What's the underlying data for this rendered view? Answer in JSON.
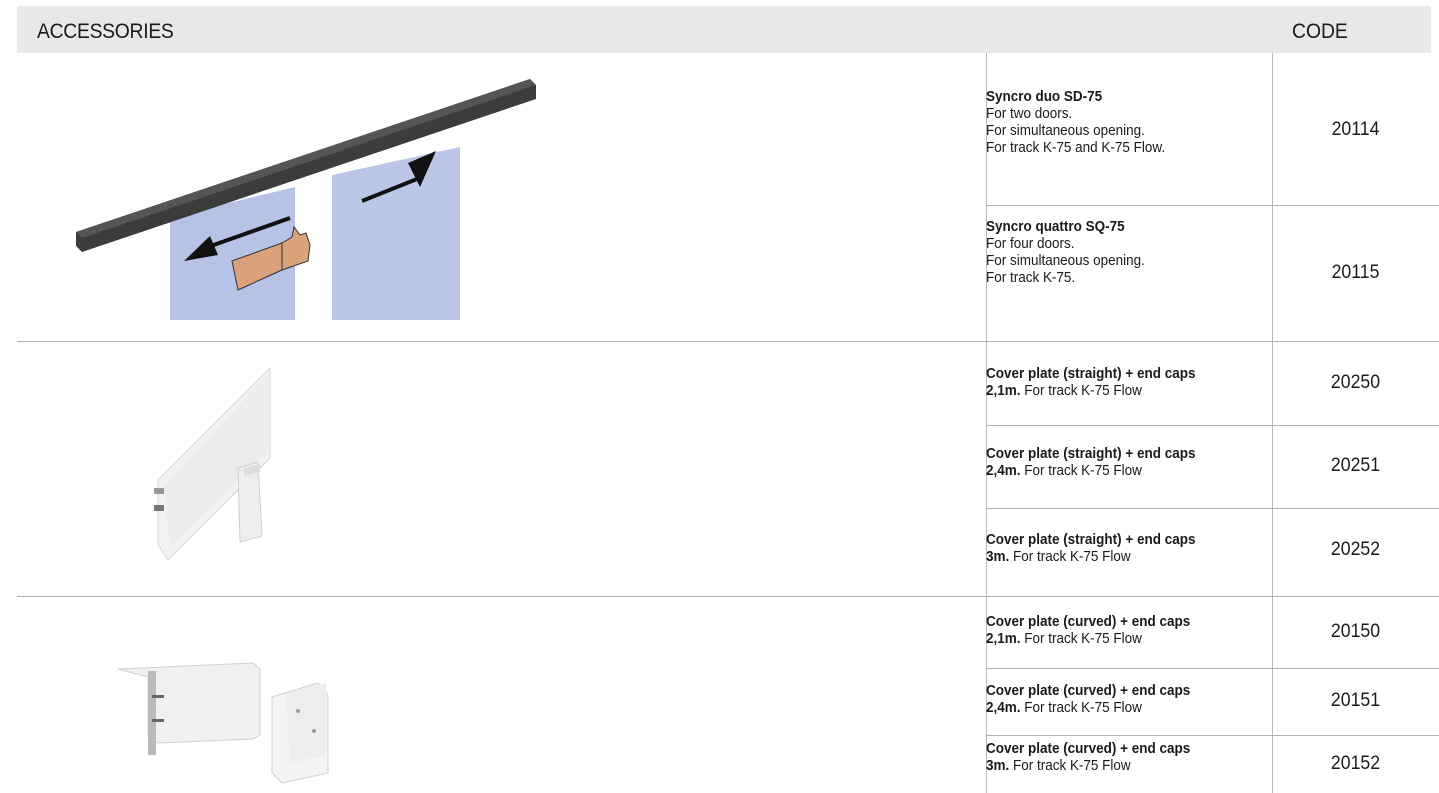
{
  "header": {
    "title": "ACCESSORIES",
    "code": "CODE"
  },
  "items": [
    {
      "name": "Syncro duo SD-75",
      "lines": [
        "For two doors.",
        "For simultaneous opening.",
        "For track K-75 and K-75 Flow."
      ],
      "code": "20114"
    },
    {
      "name": "Syncro quattro SQ-75",
      "lines": [
        "For four doors.",
        "For simultaneous opening.",
        "For track K-75."
      ],
      "code": "20115"
    },
    {
      "name": "Cover plate (straight) + end caps",
      "size": "2,1m.",
      "rest": " For track K-75 Flow",
      "code": "20250"
    },
    {
      "name": "Cover plate (straight) + end caps",
      "size": "2,4m.",
      "rest": " For track K-75 Flow",
      "code": "20251"
    },
    {
      "name": "Cover plate (straight) + end caps",
      "size": "3m.",
      "rest": " For track K-75 Flow",
      "code": "20252"
    },
    {
      "name": "Cover plate (curved) + end caps",
      "size": "2,1m.",
      "rest": " For track K-75 Flow",
      "code": "20150"
    },
    {
      "name": "Cover plate (curved) + end caps",
      "size": "2,4m.",
      "rest": " For track K-75 Flow",
      "code": "20151"
    },
    {
      "name": "Cover plate (curved) + end caps",
      "size": "3m.",
      "rest": " For track K-75 Flow",
      "code": "20152"
    }
  ],
  "colors": {
    "header_bg": "#e8e8e8",
    "door": "#b7c3e6",
    "rail": "#3a3a3a",
    "hand": "#d9a27a"
  },
  "icons": [
    "arrow-left-icon",
    "arrow-right-icon",
    "hand-icon"
  ]
}
